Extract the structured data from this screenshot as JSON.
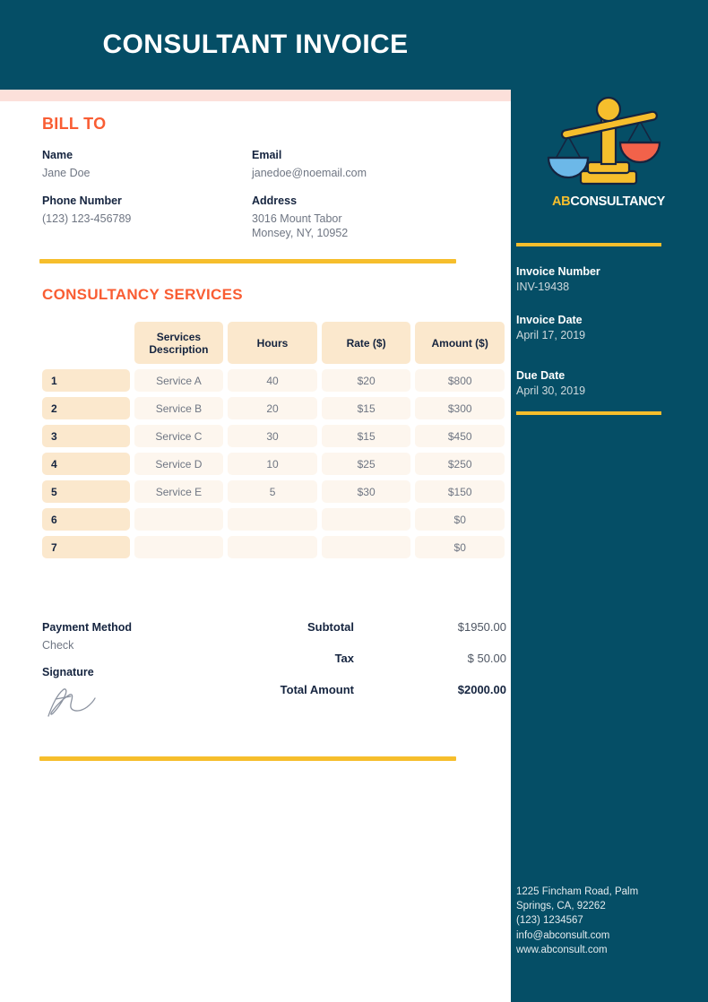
{
  "header": {
    "title": "CONSULTANT INVOICE"
  },
  "bill_to": {
    "heading": "BILL TO",
    "name_label": "Name",
    "name_value": "Jane Doe",
    "email_label": "Email",
    "email_value": "janedoe@noemail.com",
    "phone_label": "Phone Number",
    "phone_value": "(123) 123-456789",
    "address_label": "Address",
    "address_value": "3016 Mount Tabor\nMonsey, NY, 10952"
  },
  "services": {
    "heading": "CONSULTANCY SERVICES",
    "columns": [
      "",
      "Services Description",
      "Hours",
      "Rate ($)",
      "Amount ($)"
    ],
    "rows": [
      {
        "num": "1",
        "description": "Service A",
        "hours": "40",
        "rate": "$20",
        "amount": "$800"
      },
      {
        "num": "2",
        "description": "Service B",
        "hours": "20",
        "rate": "$15",
        "amount": "$300"
      },
      {
        "num": "3",
        "description": "Service C",
        "hours": "30",
        "rate": "$15",
        "amount": "$450"
      },
      {
        "num": "4",
        "description": "Service D",
        "hours": "10",
        "rate": "$25",
        "amount": "$250"
      },
      {
        "num": "5",
        "description": "Service E",
        "hours": "5",
        "rate": "$30",
        "amount": "$150"
      },
      {
        "num": "6",
        "description": "",
        "hours": "",
        "rate": "",
        "amount": "$0"
      },
      {
        "num": "7",
        "description": "",
        "hours": "",
        "rate": "",
        "amount": "$0"
      }
    ]
  },
  "payment": {
    "method_label": "Payment Method",
    "method_value": "Check",
    "signature_label": "Signature",
    "signature_icon": "handwritten-signature"
  },
  "totals": {
    "subtotal_label": "Subtotal",
    "subtotal_value": "$1950.00",
    "tax_label": "Tax",
    "tax_value": "$ 50.00",
    "total_label": "Total Amount",
    "total_value": "$2000.00"
  },
  "sidebar": {
    "logo": {
      "icon": "balance-scale-logo",
      "name_prefix": "AB",
      "name_suffix": "CONSULTANCY"
    },
    "invoice_number_label": "Invoice Number",
    "invoice_number_value": "INV-19438",
    "invoice_date_label": "Invoice Date",
    "invoice_date_value": "April 17, 2019",
    "due_date_label": "Due Date",
    "due_date_value": "April 30, 2019",
    "footer_contact": "1225 Fincham Road, Palm\nSprings, CA, 92262\n(123) 1234567\ninfo@abconsult.com\nwww.abconsult.com"
  },
  "colors": {
    "teal": "#054e66",
    "orange": "#f95d33",
    "yellow": "#f6be2c",
    "blush": "#fce0da",
    "peach": "#fbe8cd",
    "cream": "#fdf6ee",
    "navy": "#15243f",
    "logo_pan_blue": "#6cb8e8",
    "logo_pan_red": "#f2624a"
  }
}
